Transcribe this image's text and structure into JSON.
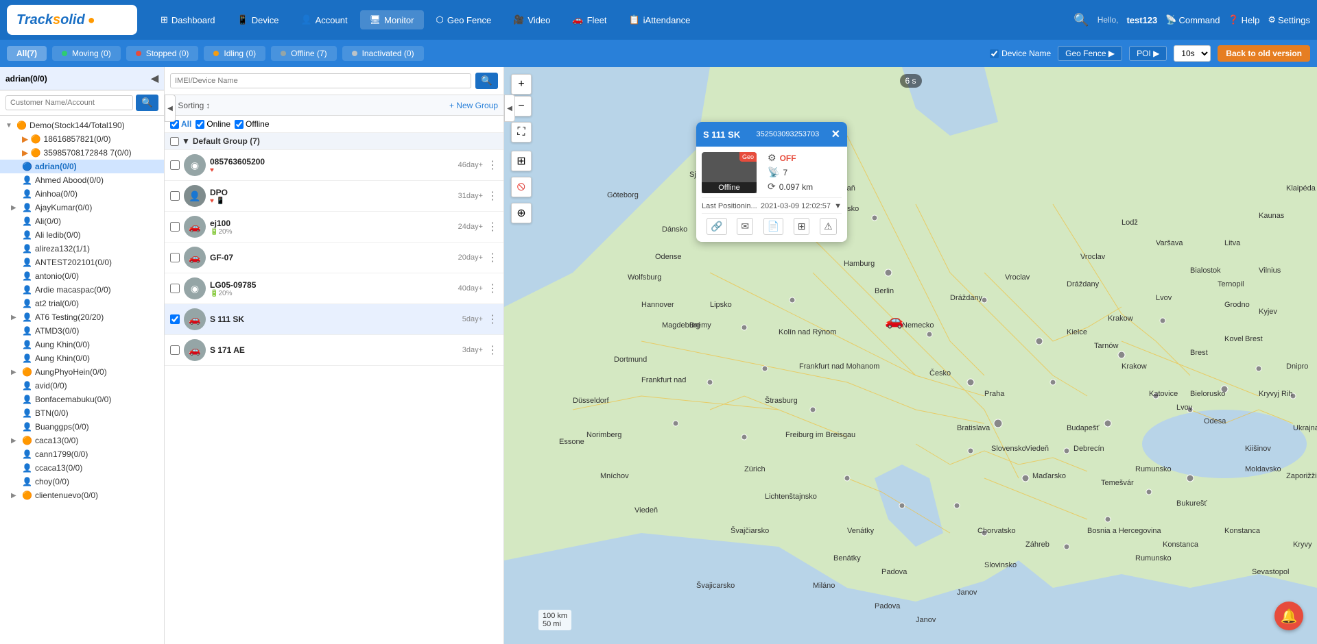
{
  "app": {
    "title": "Track solid",
    "logo_text": "Track",
    "logo_dot": "•",
    "logo_solid": "solid"
  },
  "nav": {
    "items": [
      {
        "id": "dashboard",
        "label": "Dashboard",
        "icon": "⊞"
      },
      {
        "id": "device",
        "label": "Device",
        "icon": "📱"
      },
      {
        "id": "account",
        "label": "Account",
        "icon": "👤"
      },
      {
        "id": "monitor",
        "label": "Monitor",
        "icon": "🖥"
      },
      {
        "id": "geofence",
        "label": "Geo Fence",
        "icon": "⬡"
      },
      {
        "id": "video",
        "label": "Video",
        "icon": "🎥"
      },
      {
        "id": "fleet",
        "label": "Fleet",
        "icon": "🚗"
      },
      {
        "id": "iattendance",
        "label": "iAttendance",
        "icon": "📋"
      }
    ],
    "search_icon": "🔍",
    "hello": "Hello,",
    "username": "test123",
    "command": "Command",
    "help": "Help",
    "settings": "Settings"
  },
  "subnav": {
    "all_label": "All(7)",
    "moving_label": "Moving (0)",
    "stopped_label": "Stopped (0)",
    "idling_label": "Idling (0)",
    "offline_label": "Offline (7)",
    "inactivated_label": "Inactivated (0)",
    "device_name_label": "Device Name",
    "geo_fence_label": "Geo Fence ▶",
    "poi_label": "POI ▶",
    "interval_value": "10s",
    "back_old_label": "Back to old version"
  },
  "left_panel": {
    "header_label": "adrian(0/0)",
    "search_placeholder": "Customer Name/Account",
    "tree": [
      {
        "level": 0,
        "type": "group",
        "icon": "🟠",
        "label": "Demo(Stock144/Total190)",
        "expanded": true
      },
      {
        "level": 1,
        "type": "user",
        "icon": "🟠",
        "label": "18616857821(0/0)"
      },
      {
        "level": 1,
        "type": "user",
        "icon": "🟠",
        "label": "35985708172848 7(0/0)"
      },
      {
        "level": 1,
        "type": "user-selected",
        "icon": "🔵",
        "label": "adrian(0/0)",
        "selected": true
      },
      {
        "level": 1,
        "type": "user",
        "icon": "👤",
        "label": "Ahmed Abood(0/0)"
      },
      {
        "level": 1,
        "type": "user",
        "icon": "👤",
        "label": "Ainhoa(0/0)"
      },
      {
        "level": 1,
        "type": "group",
        "icon": "👤",
        "label": "AjayKumar(0/0)"
      },
      {
        "level": 1,
        "type": "user",
        "icon": "👤",
        "label": "Ali(0/0)"
      },
      {
        "level": 1,
        "type": "user",
        "icon": "👤",
        "label": "Ali ledib(0/0)"
      },
      {
        "level": 1,
        "type": "user",
        "icon": "👤",
        "label": "alireza132(1/1)"
      },
      {
        "level": 1,
        "type": "user",
        "icon": "👤",
        "label": "ANTEST202101(0/0)"
      },
      {
        "level": 1,
        "type": "user",
        "icon": "👤",
        "label": "antonio(0/0)"
      },
      {
        "level": 1,
        "type": "user",
        "icon": "👤",
        "label": "Ardie macaspac(0/0)"
      },
      {
        "level": 1,
        "type": "user",
        "icon": "👤",
        "label": "at2 trial(0/0)"
      },
      {
        "level": 1,
        "type": "group",
        "icon": "👤",
        "label": "AT6 Testing(20/20)"
      },
      {
        "level": 1,
        "type": "user",
        "icon": "👤",
        "label": "ATMD3(0/0)"
      },
      {
        "level": 1,
        "type": "user",
        "icon": "👤",
        "label": "Aung Khin(0/0)"
      },
      {
        "level": 1,
        "type": "user",
        "icon": "👤",
        "label": "Aung Khin(0/0)"
      },
      {
        "level": 1,
        "type": "group",
        "icon": "🟠",
        "label": "AungPhyoHein(0/0)"
      },
      {
        "level": 1,
        "type": "user",
        "icon": "👤",
        "label": "avid(0/0)"
      },
      {
        "level": 1,
        "type": "user",
        "icon": "👤",
        "label": "Bonfacemabuku(0/0)"
      },
      {
        "level": 1,
        "type": "user",
        "icon": "👤",
        "label": "BTN(0/0)"
      },
      {
        "level": 1,
        "type": "user",
        "icon": "👤",
        "label": "Buanggps(0/0)"
      },
      {
        "level": 1,
        "type": "group",
        "icon": "🟠",
        "label": "caca13(0/0)"
      },
      {
        "level": 1,
        "type": "user",
        "icon": "👤",
        "label": "cann1799(0/0)"
      },
      {
        "level": 1,
        "type": "user",
        "icon": "👤",
        "label": "ccaca13(0/0)"
      },
      {
        "level": 1,
        "type": "user",
        "icon": "👤",
        "label": "choy(0/0)"
      },
      {
        "level": 1,
        "type": "group",
        "icon": "🟠",
        "label": "clientenuevo(0/0)"
      }
    ]
  },
  "mid_panel": {
    "search_placeholder": "IMEI/Device Name",
    "sorting_label": "Sorting",
    "new_group_label": "+ New Group",
    "filter_all": "All",
    "filter_online": "Online",
    "filter_offline": "Offline",
    "group_name": "Default Group (7)",
    "devices": [
      {
        "id": 1,
        "imei": "085763605200",
        "time": "46day+",
        "status": "offline",
        "battery": 0,
        "has_heart": true,
        "selected": false
      },
      {
        "id": 2,
        "name": "DPO",
        "time": "31day+",
        "status": "offline",
        "battery": 0,
        "has_heart": true,
        "has_phone": true,
        "selected": false
      },
      {
        "id": 3,
        "name": "ej100",
        "time": "24day+",
        "status": "offline",
        "battery": 20,
        "selected": false
      },
      {
        "id": 4,
        "name": "GF-07",
        "time": "20day+",
        "status": "offline",
        "battery": 0,
        "selected": false
      },
      {
        "id": 5,
        "name": "LG05-09785",
        "time": "40day+",
        "status": "offline",
        "battery": 20,
        "selected": false
      },
      {
        "id": 6,
        "name": "S 111 SK",
        "time": "5day+",
        "status": "offline",
        "battery": 0,
        "selected": true
      },
      {
        "id": 7,
        "name": "S 171 AE",
        "time": "3day+",
        "status": "offline",
        "battery": 0,
        "selected": false
      }
    ]
  },
  "popup": {
    "title": "S 111 SK",
    "phone": "352503093253703",
    "status": "Offline",
    "acc": "OFF",
    "signal": "7",
    "odometer": "0.097 km",
    "last_pos_label": "Last Positionin...",
    "last_pos_time": "2021-03-09 12:02:57",
    "geo_badge": "Geo"
  },
  "map": {
    "time_badge": "6 s",
    "scale_100km": "100 km",
    "scale_50mi": "50 mi"
  },
  "colors": {
    "primary": "#1a6fc4",
    "secondary": "#2980d9",
    "accent": "#e67e22",
    "offline": "#95a5a6",
    "online": "#2ecc71",
    "danger": "#e74c3c"
  }
}
